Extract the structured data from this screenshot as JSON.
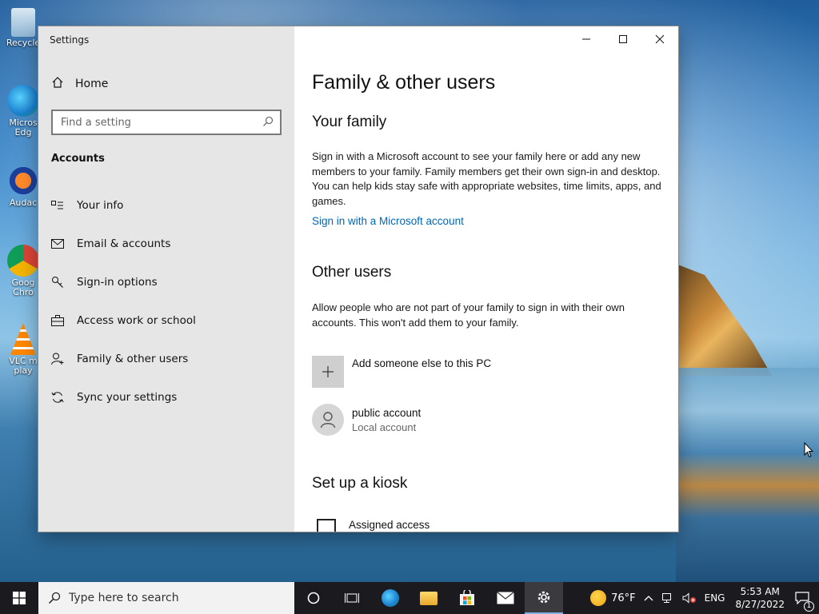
{
  "desktop": {
    "icons": [
      {
        "name": "recycle-bin",
        "label": "Recycle"
      },
      {
        "name": "edge",
        "label": "Micros Edg"
      },
      {
        "name": "audacity",
        "label": "Audac"
      },
      {
        "name": "chrome",
        "label": "Goog Chro"
      },
      {
        "name": "vlc",
        "label": "VLC m play"
      }
    ]
  },
  "window": {
    "title": "Settings",
    "controls": {
      "minimize": "—",
      "maximize": "☐",
      "close": "✕"
    }
  },
  "sidebar": {
    "home_label": "Home",
    "search_placeholder": "Find a setting",
    "section": "Accounts",
    "items": [
      {
        "label": "Your info",
        "icon": "contact-card-icon"
      },
      {
        "label": "Email & accounts",
        "icon": "mail-icon"
      },
      {
        "label": "Sign-in options",
        "icon": "key-icon"
      },
      {
        "label": "Access work or school",
        "icon": "briefcase-icon"
      },
      {
        "label": "Family & other users",
        "icon": "add-person-icon"
      },
      {
        "label": "Sync your settings",
        "icon": "sync-icon"
      }
    ]
  },
  "content": {
    "title": "Family & other users",
    "family": {
      "heading": "Your family",
      "text": "Sign in with a Microsoft account to see your family here or add any new members to your family. Family members get their own sign-in and desktop. You can help kids stay safe with appropriate websites, time limits, apps, and games.",
      "link": "Sign in with a Microsoft account"
    },
    "other": {
      "heading": "Other users",
      "text": "Allow people who are not part of your family to sign in with their own accounts. This won't add them to your family.",
      "add_label": "Add someone else to this PC",
      "user_name": "public account",
      "user_type": "Local account"
    },
    "kiosk": {
      "heading": "Set up a kiosk",
      "item": "Assigned access"
    }
  },
  "taskbar": {
    "search_placeholder": "Type here to search",
    "weather": "76°F",
    "language": "ENG",
    "time": "5:53 AM",
    "date": "8/27/2022",
    "notification_count": "1"
  },
  "colors": {
    "accent": "#0067b8",
    "sidebar_bg": "#e6e6e6",
    "taskbar_bg": "#1b1b1f"
  }
}
